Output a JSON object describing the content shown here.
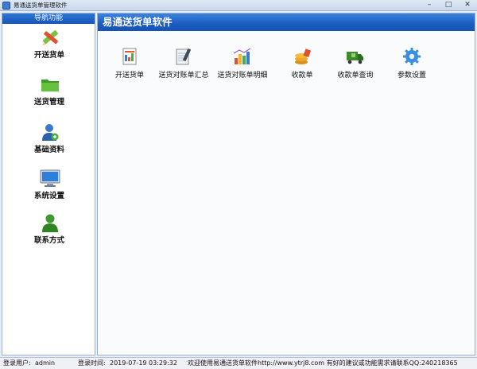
{
  "window": {
    "title": "易通送货单管理软件"
  },
  "sidebar": {
    "header": "导航功能",
    "items": [
      {
        "label": "开送货单",
        "icon": "pencil-ruler-icon"
      },
      {
        "label": "送货管理",
        "icon": "folder-icon"
      },
      {
        "label": "基础资料",
        "icon": "user-icon"
      },
      {
        "label": "系统设置",
        "icon": "monitor-icon"
      },
      {
        "label": "联系方式",
        "icon": "contact-person-icon"
      }
    ]
  },
  "main": {
    "title": "易通送货单软件",
    "toolbar": [
      {
        "label": "开送货单",
        "icon": "invoice-icon"
      },
      {
        "label": "送货对账单汇总",
        "icon": "notepad-pencil-icon"
      },
      {
        "label": "送货对账单明细",
        "icon": "chart-books-icon"
      },
      {
        "label": "收款单",
        "icon": "coins-icon"
      },
      {
        "label": "收款单查询",
        "icon": "delivery-truck-icon"
      },
      {
        "label": "参数设置",
        "icon": "gear-icon"
      }
    ]
  },
  "status": {
    "user_label": "登录用户:",
    "user_value": "admin",
    "time_label": "登录时间:",
    "time_value": "2019-07-19  03:29:32",
    "message": "欢迎使用易通送货单软件http://www.ytrj8.com 有好的建议或功能需求请联系QQ:240218365"
  },
  "colors": {
    "accent": "#1a5cbf",
    "sidebar_header": "#2f78d6",
    "window_bg": "#e8ecf3"
  }
}
